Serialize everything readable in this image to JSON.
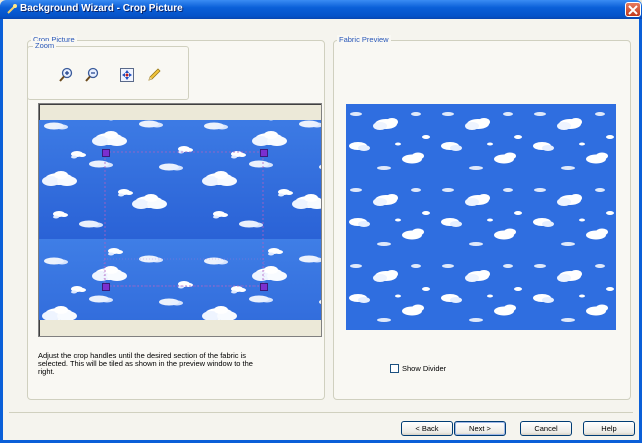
{
  "window": {
    "title": "Background Wizard - Crop Picture"
  },
  "crop_group": {
    "label": "Crop Picture"
  },
  "zoom_group": {
    "label": "Zoom",
    "tools": [
      {
        "name": "zoom-in-icon",
        "tooltip": "Zoom In"
      },
      {
        "name": "zoom-out-icon",
        "tooltip": "Zoom Out"
      },
      {
        "name": "zoom-fit-icon",
        "tooltip": "Zoom to Fit"
      },
      {
        "name": "pencil-icon",
        "tooltip": "Edit"
      }
    ]
  },
  "instructions": "Adjust the crop handles until the desired section of the fabric is\nselected. This will be tiled as shown in the preview window to the\nright.",
  "preview_group": {
    "label": "Fabric Preview"
  },
  "show_divider": {
    "label": "Show Divider",
    "checked": false
  },
  "buttons": {
    "back": "< Back",
    "next": "Next >",
    "cancel": "Cancel",
    "help": "Help"
  },
  "colors": {
    "sky": "#2e6fe0",
    "handle": "#7b2fcf",
    "title_bar": "#0a5fd8"
  }
}
